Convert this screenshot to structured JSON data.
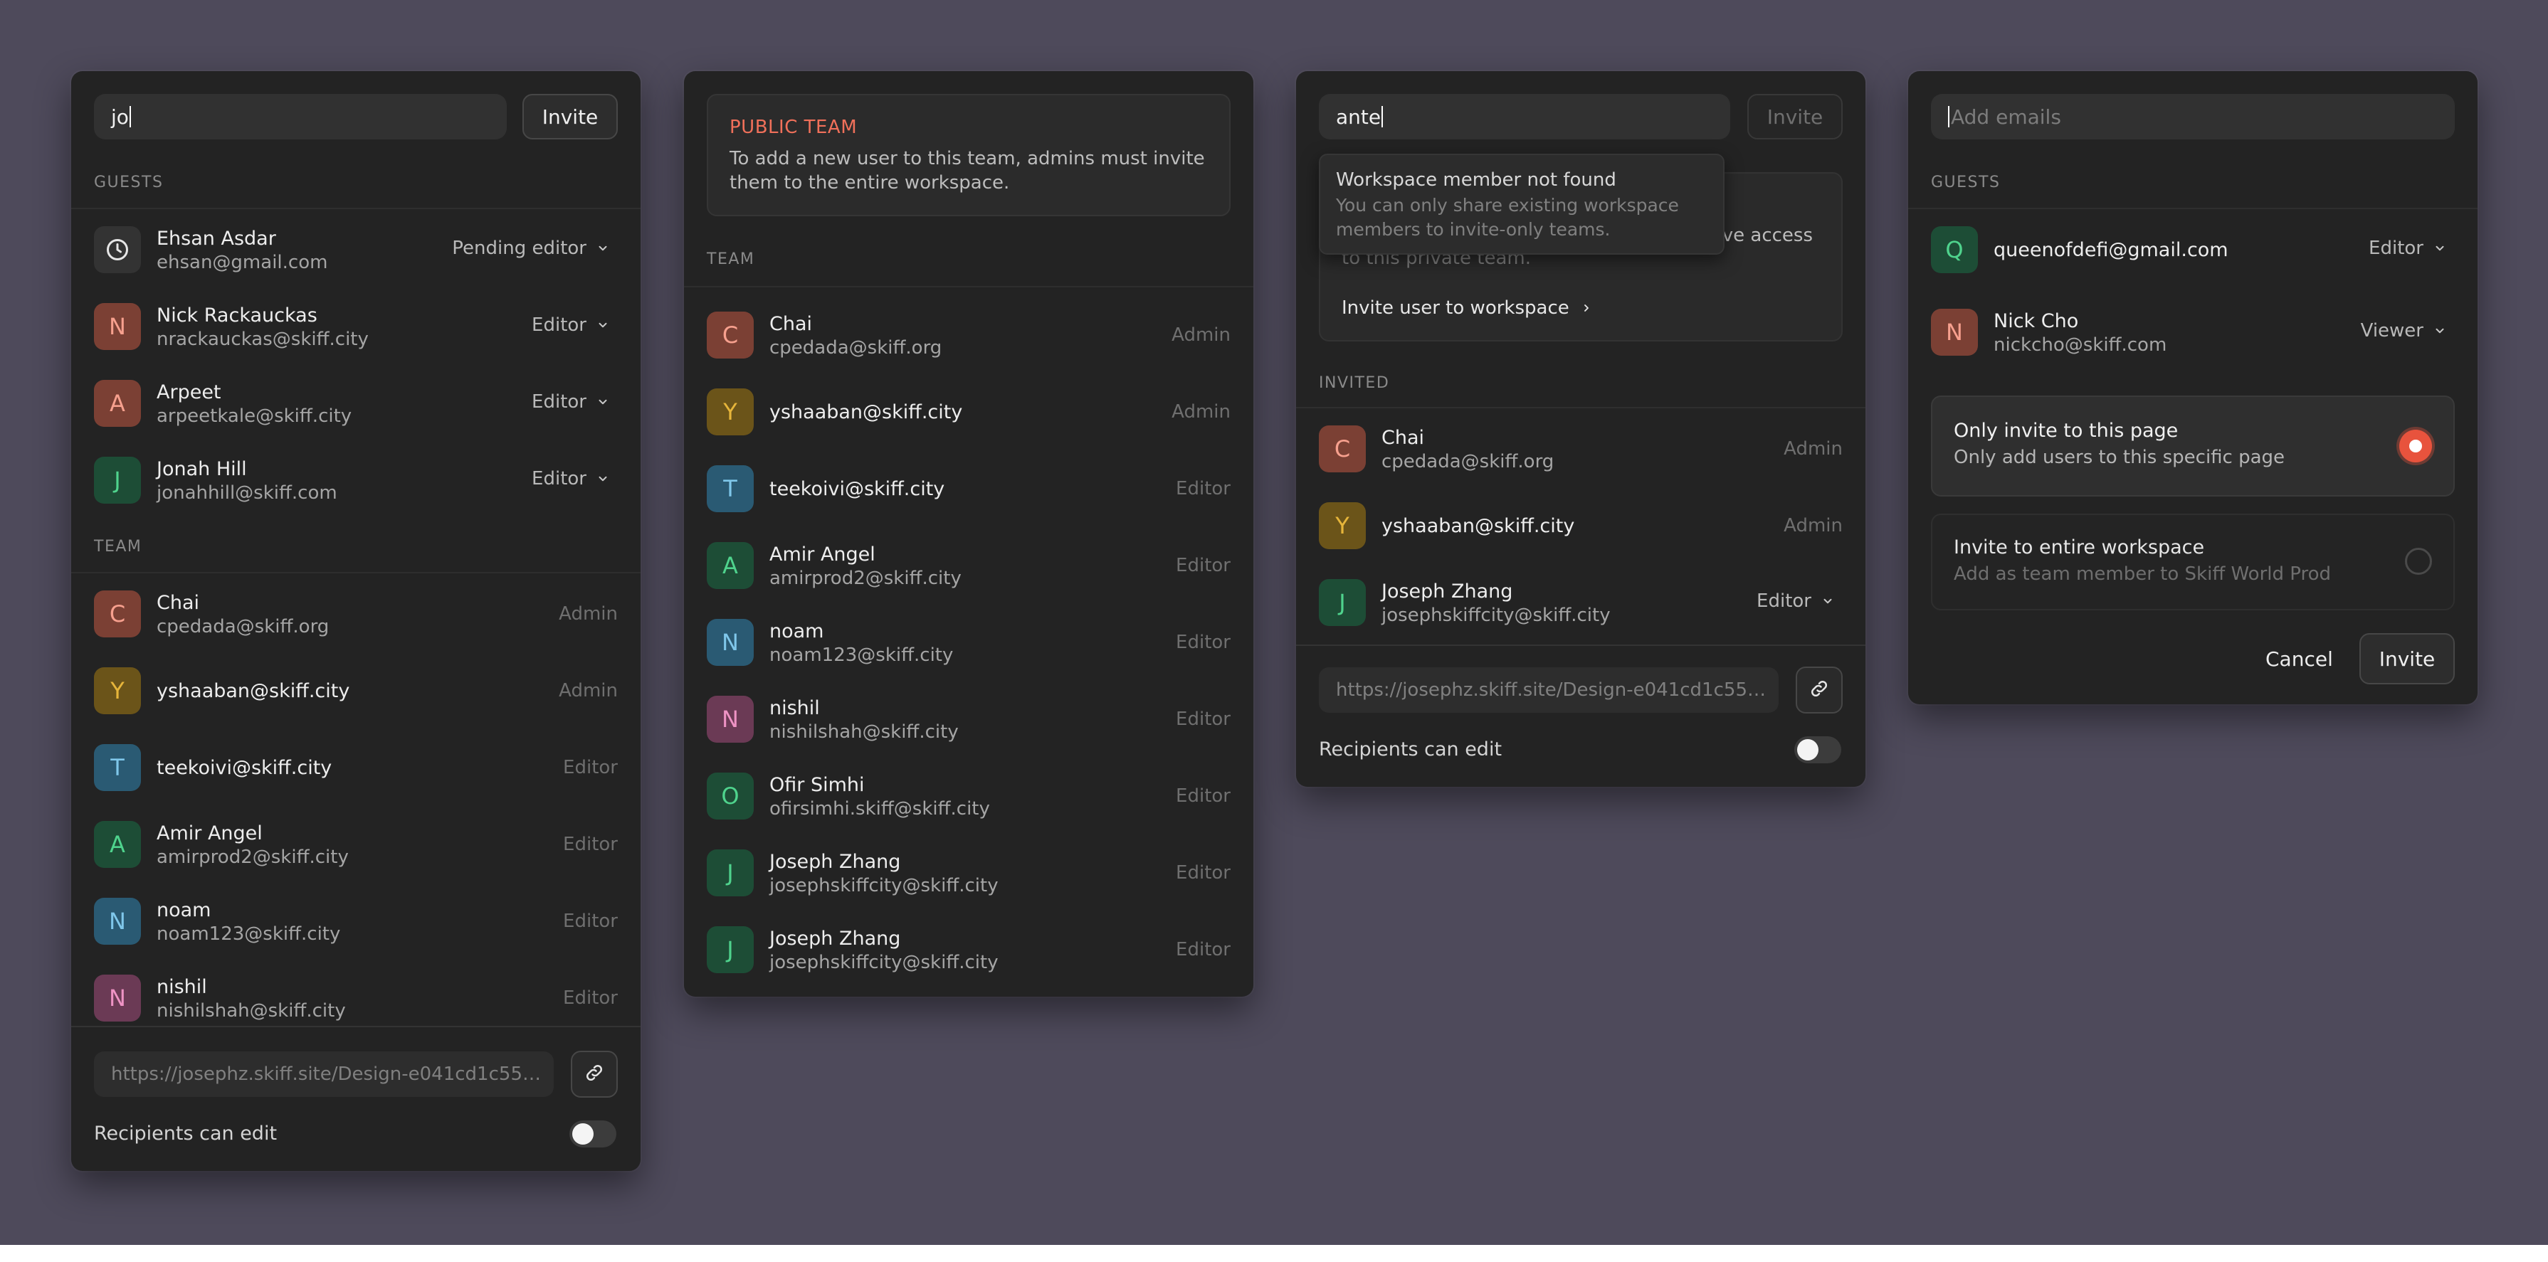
{
  "colors": {
    "background": "#4e4a5b",
    "panel": "#232323",
    "accent_orange": "#f0705a",
    "radio_selected": "#e8533d"
  },
  "panel1": {
    "search_value": "jo",
    "invite_label": "Invite",
    "guests_label": "GUESTS",
    "guests": [
      {
        "avatar": "clock-icon",
        "name": "Ehsan Asdar",
        "email": "ehsan@gmail.com",
        "role": "Pending editor"
      },
      {
        "initial": "N",
        "name": "Nick Rackauckas",
        "email": "nrackauckas@skiff.city",
        "role": "Editor"
      },
      {
        "initial": "A",
        "name": "Arpeet",
        "email": "arpeetkale@skiff.city",
        "role": "Editor"
      },
      {
        "initial": "J",
        "name": "Jonah Hill",
        "email": "jonahhill@skiff.com",
        "role": "Editor"
      }
    ],
    "team_label": "TEAM",
    "team": [
      {
        "initial": "C",
        "name": "Chai",
        "email": "cpedada@skiff.org",
        "role": "Admin"
      },
      {
        "initial": "Y",
        "name": "yshaaban@skiff.city",
        "role": "Admin"
      },
      {
        "initial": "T",
        "name": "teekoivi@skiff.city",
        "role": "Editor"
      },
      {
        "initial": "A",
        "name": "Amir Angel",
        "email": "amirprod2@skiff.city",
        "role": "Editor"
      },
      {
        "initial": "N",
        "name": "noam",
        "email": "noam123@skiff.city",
        "role": "Editor"
      },
      {
        "initial": "N",
        "name": "nishil",
        "email": "nishilshah@skiff.city",
        "role": "Editor"
      }
    ],
    "link": "https://josephz.skiff.site/Design-e041cd1c55…",
    "recipients_label": "Recipients can edit"
  },
  "panel2": {
    "banner_title": "PUBLIC TEAM",
    "banner_text_1": "To add a new user to this team, admins must invite",
    "banner_text_2": "them to the entire workspace.",
    "team_label": "TEAM",
    "team": [
      {
        "initial": "C",
        "name": "Chai",
        "email": "cpedada@skiff.org",
        "role": "Admin"
      },
      {
        "initial": "Y",
        "name": "yshaaban@skiff.city",
        "role": "Admin"
      },
      {
        "initial": "T",
        "name": "teekoivi@skiff.city",
        "role": "Editor"
      },
      {
        "initial": "A",
        "name": "Amir Angel",
        "email": "amirprod2@skiff.city",
        "role": "Editor"
      },
      {
        "initial": "N",
        "name": "noam",
        "email": "noam123@skiff.city",
        "role": "Editor"
      },
      {
        "initial": "N",
        "name": "nishil",
        "email": "nishilshah@skiff.city",
        "role": "Editor"
      },
      {
        "initial": "O",
        "name": "Ofir Simhi",
        "email": "ofirsimhi.skiff@skiff.city",
        "role": "Editor"
      },
      {
        "initial": "J",
        "name": "Joseph Zhang",
        "email": "josephskiffcity@skiff.city",
        "role": "Editor"
      },
      {
        "initial": "J",
        "name": "Joseph Zhang",
        "email": "josephskiffcity@skiff.city",
        "role": "Editor"
      }
    ]
  },
  "panel3": {
    "search_value": "ante",
    "invite_label": "Invite",
    "tooltip_title": "Workspace member not found",
    "tooltip_text_1": "You can only share existing workspace",
    "tooltip_text_2": "members to invite-only teams.",
    "hidden_text_1": "ve access",
    "hidden_text_2": "to this private team.",
    "invite_workspace_label": "Invite user to workspace",
    "invited_label": "INVITED",
    "invited": [
      {
        "initial": "C",
        "name": "Chai",
        "email": "cpedada@skiff.org",
        "role": "Admin"
      },
      {
        "initial": "Y",
        "name": "yshaaban@skiff.city",
        "role": "Admin"
      },
      {
        "initial": "J",
        "name": "Joseph Zhang",
        "email": "josephskiffcity@skiff.city",
        "role": "Editor"
      }
    ],
    "link": "https://josephz.skiff.site/Design-e041cd1c55…",
    "recipients_label": "Recipients can edit"
  },
  "panel4": {
    "placeholder": "Add emails",
    "guests_label": "GUESTS",
    "guests": [
      {
        "initial": "Q",
        "name": "queenofdefi@gmail.com",
        "role": "Editor"
      },
      {
        "initial": "N",
        "name": "Nick Cho",
        "email": "nickcho@skiff.com",
        "role": "Viewer"
      }
    ],
    "options": [
      {
        "title": "Only invite to this page",
        "desc": "Only add users to this specific page",
        "selected": true
      },
      {
        "title": "Invite to entire workspace",
        "desc": "Add as team member to Skiff World Prod",
        "selected": false
      }
    ],
    "cancel_label": "Cancel",
    "invite_label": "Invite"
  }
}
